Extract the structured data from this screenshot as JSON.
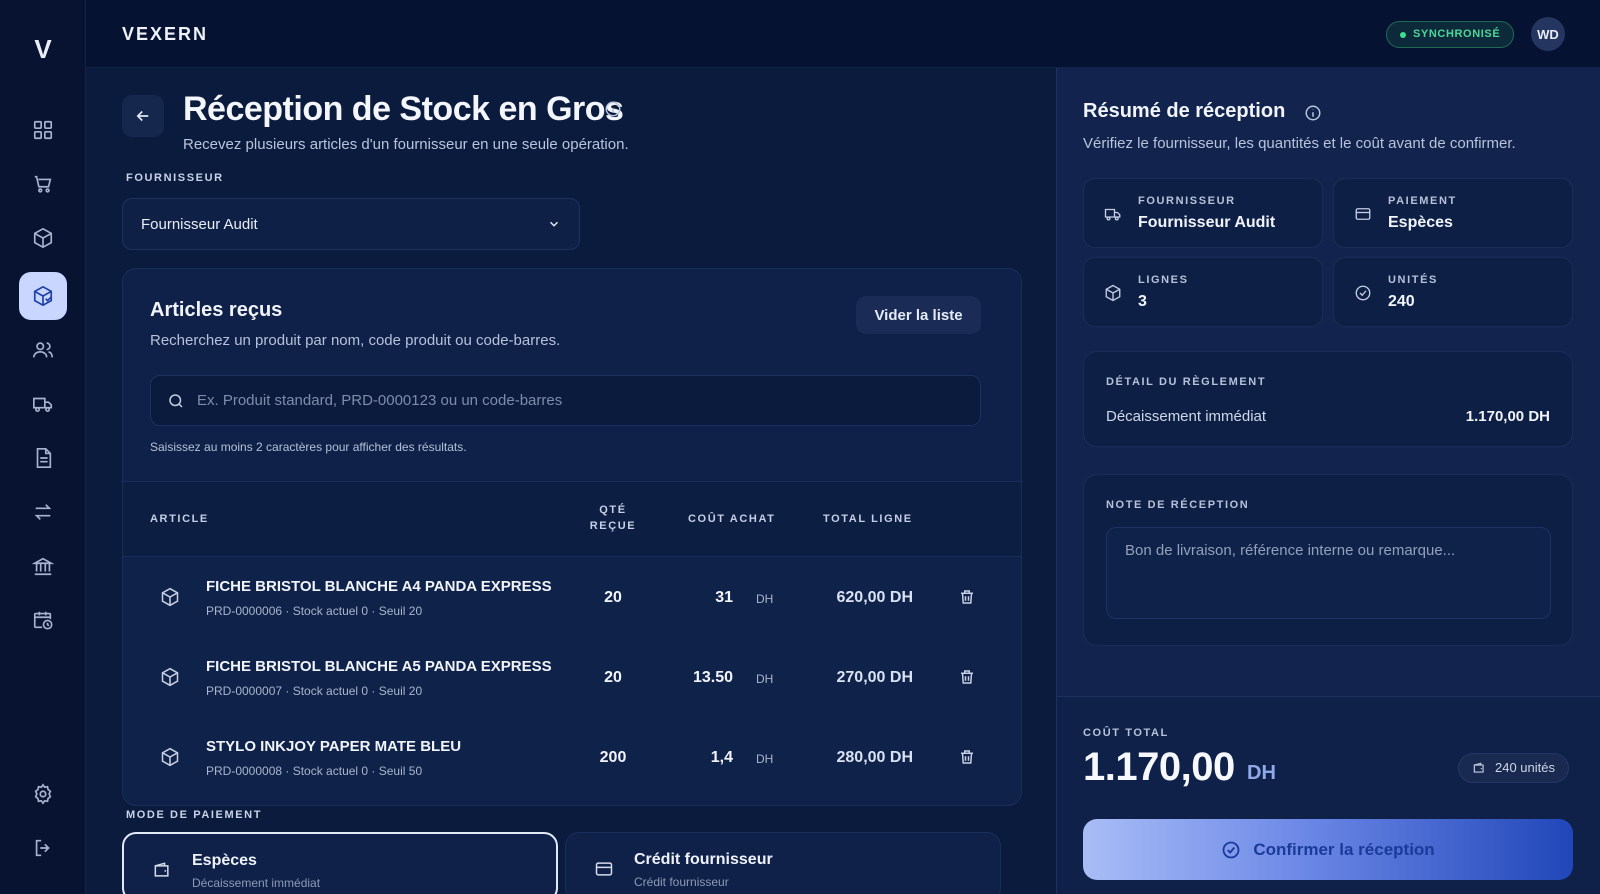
{
  "app": {
    "logo_letter": "V",
    "brand": "VEXERN"
  },
  "topbar": {
    "sync_status": "SYNCHRONISÉ",
    "avatar_initials": "WD"
  },
  "sidebar": {
    "items": [
      {
        "icon": "dashboard-icon"
      },
      {
        "icon": "cart-icon"
      },
      {
        "icon": "box-icon"
      },
      {
        "icon": "stock-reception-icon",
        "active": true
      },
      {
        "icon": "users-icon"
      },
      {
        "icon": "truck-icon"
      },
      {
        "icon": "document-icon"
      },
      {
        "icon": "transfer-icon"
      },
      {
        "icon": "bank-icon"
      },
      {
        "icon": "calendar-clock-icon"
      }
    ],
    "bottom": [
      {
        "icon": "settings-icon"
      },
      {
        "icon": "logout-icon"
      }
    ]
  },
  "page": {
    "title": "Réception de Stock en Gros",
    "subtitle": "Recevez plusieurs articles d'un fournisseur en une seule opération.",
    "supplier_label": "FOURNISSEUR",
    "supplier_selected": "Fournisseur Audit"
  },
  "articles": {
    "title": "Articles reçus",
    "subtitle": "Recherchez un produit par nom, code produit ou code-barres.",
    "clear_label": "Vider la liste",
    "search_placeholder": "Ex. Produit standard, PRD-0000123 ou un code-barres",
    "hint": "Saisissez au moins 2 caractères pour afficher des résultats.",
    "columns": {
      "article": "ARTICLE",
      "qty_line1": "QTÉ",
      "qty_line2": "REÇUE",
      "cost": "COÛT ACHAT",
      "total": "TOTAL LIGNE"
    },
    "rows": [
      {
        "name": "FICHE BRISTOL BLANCHE A4 PANDA EXPRESS",
        "meta": "PRD-0000006 · Stock actuel 0 · Seuil 20",
        "qty": "20",
        "cost": "31",
        "currency": "DH",
        "total": "620,00 DH"
      },
      {
        "name": "FICHE BRISTOL BLANCHE A5 PANDA EXPRESS",
        "meta": "PRD-0000007 · Stock actuel 0 · Seuil 20",
        "qty": "20",
        "cost": "13.50",
        "currency": "DH",
        "total": "270,00 DH"
      },
      {
        "name": "STYLO INKJOY PAPER MATE BLEU",
        "meta": "PRD-0000008 · Stock actuel 0 · Seuil 50",
        "qty": "200",
        "cost": "1,4",
        "currency": "DH",
        "total": "280,00 DH"
      }
    ]
  },
  "payment_mode": {
    "label": "MODE DE PAIEMENT",
    "options": [
      {
        "label": "Espèces",
        "sub": "Décaissement immédiat",
        "selected": true
      },
      {
        "label": "Crédit fournisseur",
        "sub": "Crédit fournisseur",
        "selected": false
      }
    ]
  },
  "summary": {
    "title": "Résumé de réception",
    "subtitle": "Vérifiez le fournisseur, les quantités et le coût avant de confirmer.",
    "tiles": {
      "supplier": {
        "label": "FOURNISSEUR",
        "value": "Fournisseur Audit"
      },
      "payment": {
        "label": "PAIEMENT",
        "value": "Espèces"
      },
      "lines": {
        "label": "LIGNES",
        "value": "3"
      },
      "units": {
        "label": "UNITÉS",
        "value": "240"
      }
    },
    "settlement": {
      "label": "DÉTAIL DU RÈGLEMENT",
      "name": "Décaissement immédiat",
      "amount": "1.170,00 DH"
    },
    "note": {
      "label": "NOTE DE RÉCEPTION",
      "placeholder": "Bon de livraison, référence interne ou remarque..."
    },
    "total": {
      "label": "COÛT TOTAL",
      "amount": "1.170,00",
      "currency": "DH",
      "units_badge": "240 unités"
    },
    "confirm_label": "Confirmer la réception"
  },
  "colors": {
    "accent": "#c9d6ff",
    "success": "#3ee08f",
    "background": "#0a1a3a"
  }
}
